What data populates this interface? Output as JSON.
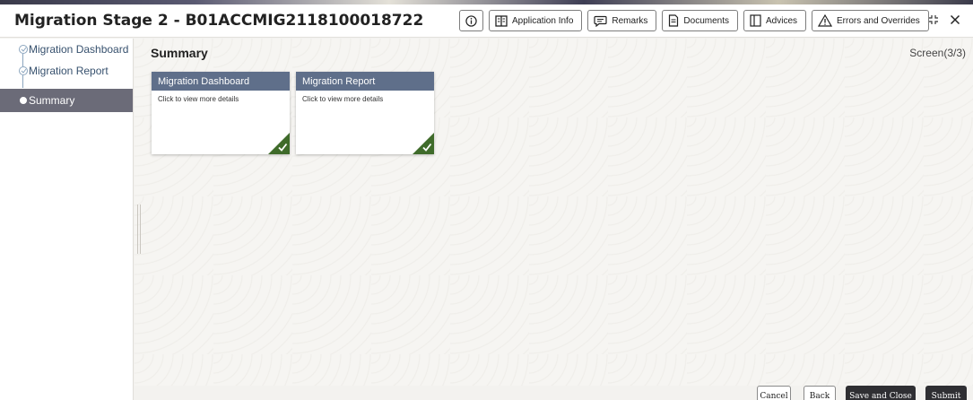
{
  "header": {
    "title": "Migration Stage 2 - B01ACCMIG2118100018722",
    "buttons": [
      {
        "label": "",
        "icon": "info-icon"
      },
      {
        "label": "Application Info",
        "icon": "book-icon"
      },
      {
        "label": "Remarks",
        "icon": "comment-icon"
      },
      {
        "label": "Documents",
        "icon": "document-icon"
      },
      {
        "label": "Advices",
        "icon": "columns-icon"
      },
      {
        "label": "Errors and Overrides",
        "icon": "warning-icon"
      }
    ]
  },
  "sidebar": {
    "items": [
      {
        "label": "Migration Dashboard",
        "state": "completed"
      },
      {
        "label": "Migration Report",
        "state": "completed"
      },
      {
        "label": "Summary",
        "state": "active"
      }
    ]
  },
  "main": {
    "title": "Summary",
    "screen_indicator": "Screen(3/3)",
    "cards": [
      {
        "title": "Migration Dashboard",
        "subtitle": "Click to view more details",
        "status": "complete"
      },
      {
        "title": "Migration Report",
        "subtitle": "Click to view more details",
        "status": "complete"
      }
    ]
  },
  "footer": {
    "cancel_label": "Cancel",
    "back_label": "Back",
    "save_close_label": "Save and Close",
    "submit_label": "Submit"
  },
  "colors": {
    "card_header": "#5f6f8a",
    "check_green": "#3f6b2a",
    "active_nav": "#6b6b78",
    "primary_button": "#2f2f33"
  }
}
